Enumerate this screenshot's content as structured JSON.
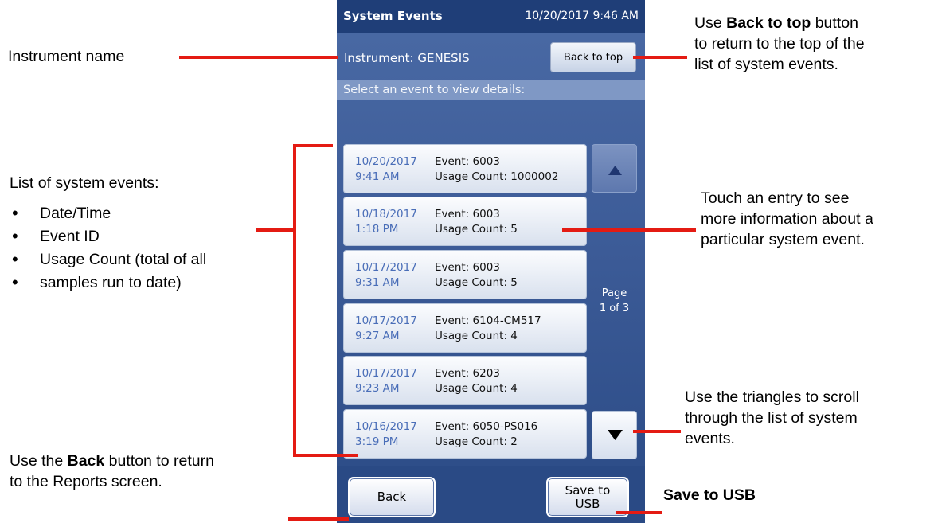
{
  "screen": {
    "title": "System Events",
    "datetime": "10/20/2017 9:46 AM",
    "instrument_label": "Instrument:",
    "instrument_name": "GENESIS",
    "back_to_top_label": "Back to top",
    "prompt": "Select an event to view details:",
    "events": [
      {
        "date": "10/20/2017",
        "time": "9:41 AM",
        "event": "Event: 6003",
        "usage": "Usage Count: 1000002"
      },
      {
        "date": "10/18/2017",
        "time": "1:18 PM",
        "event": "Event: 6003",
        "usage": "Usage Count: 5"
      },
      {
        "date": "10/17/2017",
        "time": "9:31 AM",
        "event": "Event: 6003",
        "usage": "Usage Count: 5"
      },
      {
        "date": "10/17/2017",
        "time": "9:27 AM",
        "event": "Event: 6104-CM517",
        "usage": "Usage Count: 4"
      },
      {
        "date": "10/17/2017",
        "time": "9:23 AM",
        "event": "Event: 6203",
        "usage": "Usage Count: 4"
      },
      {
        "date": "10/16/2017",
        "time": "3:19 PM",
        "event": "Event: 6050-PS016",
        "usage": "Usage Count: 2"
      }
    ],
    "page_line1": "Page",
    "page_line2": "1 of 3",
    "back_label": "Back",
    "save_label_line1": "Save to",
    "save_label_line2": "USB",
    "colors": {
      "title_bar": "#1f3e78",
      "background": "#3d5c98",
      "prompt_bar": "#7f98c5",
      "date_text": "#4a6eb8",
      "callout_line": "#e41b13"
    },
    "icons": {
      "scroll_up": "triangle-up-icon",
      "scroll_down": "triangle-down-icon"
    }
  },
  "annotations": {
    "instrument_name": "Instrument name",
    "back_to_top_bold": "Back to top",
    "back_to_top_pre": "Use ",
    "back_to_top_post1": " button",
    "back_to_top_post2": "to return to the top of the",
    "back_to_top_post3": "list of system events.",
    "list_title": "List of system events:",
    "list_items": [
      "Date/Time",
      "Event ID",
      "Usage Count (total of all",
      "samples run to date)"
    ],
    "touch_entry": [
      "Touch an entry to see",
      "more information about a",
      "particular system event."
    ],
    "triangles": [
      "Use the triangles to scroll",
      "through the list of system",
      "events."
    ],
    "back_pre": "Use the ",
    "back_bold": "Back",
    "back_post1": " button to return",
    "back_post2": "to the Reports screen.",
    "save_usb": "Save to USB"
  }
}
